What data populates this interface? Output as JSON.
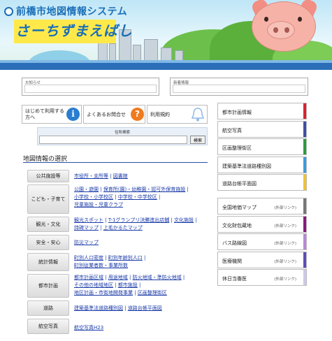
{
  "header": {
    "system_title": "前橋市地図情報システム",
    "logo_text": "さーちずまえばし"
  },
  "notices": {
    "oshirase": "お知らせ",
    "shinchaku": "新着情報"
  },
  "help": {
    "first_time": "はじめて利用する方へ",
    "faq": "よくあるお問合せ",
    "terms": "利用規約"
  },
  "search": {
    "caption": "住所検索",
    "button": "検索",
    "value": ""
  },
  "mapinfo": {
    "title": "地図情報の選択",
    "categories": [
      {
        "label": "公共施設等",
        "links": [
          "市役所・支所等",
          "図書館"
        ]
      },
      {
        "label": "こども・子育て",
        "links": [
          "公園・遊園",
          "保育所(園)・幼稚園・認可外保育施設",
          "小学校・小学校区",
          "中学校・中学校区",
          "児童施設・児童クラブ"
        ]
      },
      {
        "label": "観光・文化",
        "links": [
          "観光スポット",
          "T-1グランプリ決勝進出店舗",
          "文化施設",
          "詩碑マップ",
          "上毛かるたマップ"
        ]
      },
      {
        "label": "安全・安心",
        "links": [
          "防災マップ"
        ]
      },
      {
        "label": "統計情報",
        "links": [
          "町別人口密度",
          "町別年齢別人口",
          "町別従業者数・事業所数"
        ]
      },
      {
        "label": "都市計画",
        "links": [
          "都市計画区域",
          "用途地域",
          "防火地域・準防火地域",
          "その他の地域地区",
          "都市施設",
          "地区計画・市街地開発事業",
          "区画整理街区"
        ]
      },
      {
        "label": "道路",
        "links": [
          "建築基準法道路種別図",
          "道路台帳平面図"
        ]
      },
      {
        "label": "航空写真",
        "links": [
          "航空写真H23"
        ]
      }
    ]
  },
  "right_menu": {
    "internal": [
      {
        "label": "都市計画情報",
        "color": "#d9232e"
      },
      {
        "label": "航空写真",
        "color": "#3e4fa6"
      },
      {
        "label": "区画整理街区",
        "color": "#2e9a3e"
      },
      {
        "label": "建築基準法道路種別図",
        "color": "#3b9be0"
      },
      {
        "label": "道路台帳平面図",
        "color": "#f2c230"
      }
    ],
    "external_label": "(外部リンク)",
    "external": [
      {
        "label": "全国地価マップ",
        "color": "#777777"
      },
      {
        "label": "文化財包蔵地",
        "color": "#8a1a7e"
      },
      {
        "label": "バス路線図",
        "color": "#b989d6"
      },
      {
        "label": "医療機関",
        "color": "#5b4fb8"
      },
      {
        "label": "休日当番医",
        "color": "#cfc6ea"
      }
    ]
  }
}
